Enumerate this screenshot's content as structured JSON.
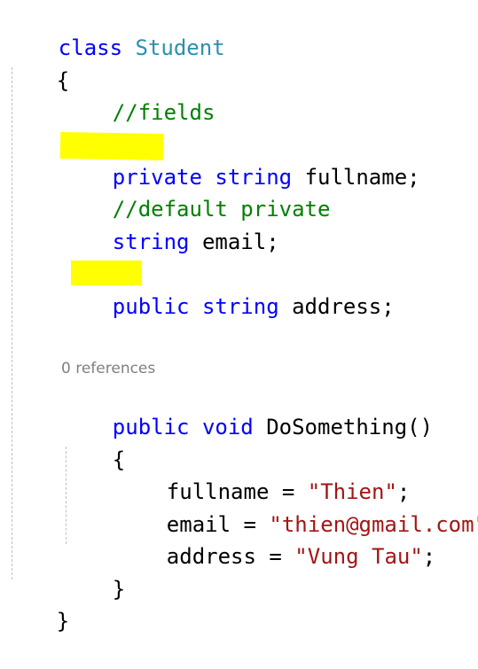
{
  "code": {
    "class_keyword": "class",
    "class_name": "Student",
    "open_brace": "{",
    "close_brace": "}",
    "comment_fields": "//fields",
    "private_keyword": "private",
    "string_type": "string",
    "fullname_decl": "fullname;",
    "comment_default": "//default private",
    "email_decl": "email;",
    "public_keyword": "public",
    "address_decl": "address;",
    "codelens": "0 references",
    "void_keyword": "void",
    "method_sig": "DoSomething()",
    "assign_fullname_lhs": "fullname = ",
    "assign_fullname_val": "\"Thien\"",
    "assign_email_lhs": "email = ",
    "assign_email_val": "\"thien@gmail.com\"",
    "assign_address_lhs": "address = ",
    "assign_address_val": "\"Vung Tau\"",
    "semicolon": ";"
  },
  "colors": {
    "keyword": "#0000ff",
    "type": "#2b91af",
    "comment": "#008000",
    "string": "#a31515",
    "highlight": "#ffff00"
  }
}
